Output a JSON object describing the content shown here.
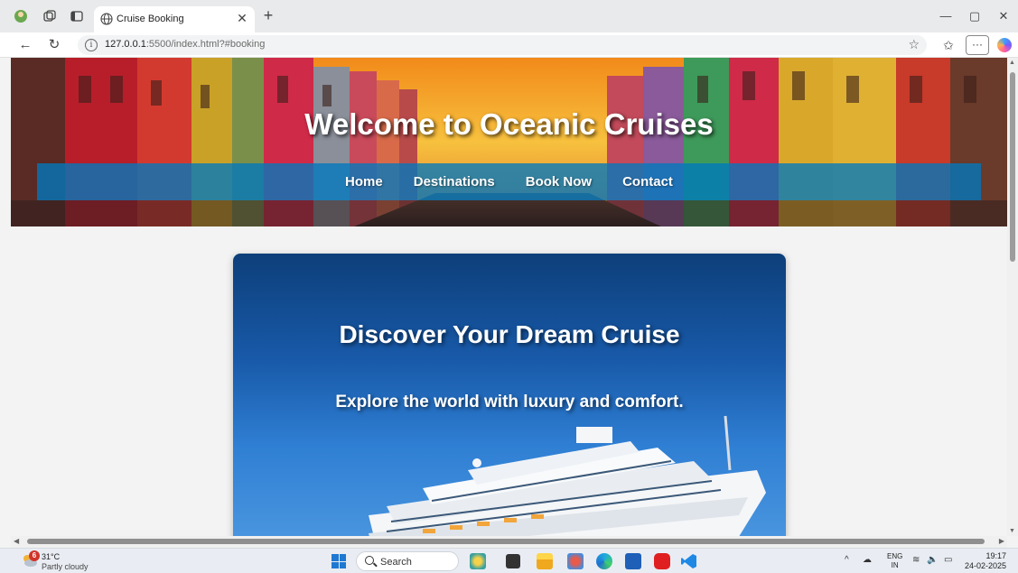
{
  "browser": {
    "tab_title": "Cruise Booking",
    "url_host": "127.0.0.1",
    "url_rest": ":5500/index.html?#booking"
  },
  "page": {
    "hero_title": "Welcome to Oceanic Cruises",
    "nav": [
      {
        "label": "Home"
      },
      {
        "label": "Destinations"
      },
      {
        "label": "Book Now"
      },
      {
        "label": "Contact"
      }
    ],
    "card_title": "Discover Your Dream Cruise",
    "card_subtitle": "Explore the world with luxury and comfort."
  },
  "taskbar": {
    "weather_badge": "6",
    "weather_temp": "31°C",
    "weather_desc": "Partly cloudy",
    "search_label": "Search",
    "lang_top": "ENG",
    "lang_bottom": "IN",
    "time": "19:17",
    "date": "24-02-2025"
  },
  "colors": {
    "nav_bar": "#0078be",
    "card_top": "#0d3f7a",
    "card_bottom": "#4d98e0"
  }
}
